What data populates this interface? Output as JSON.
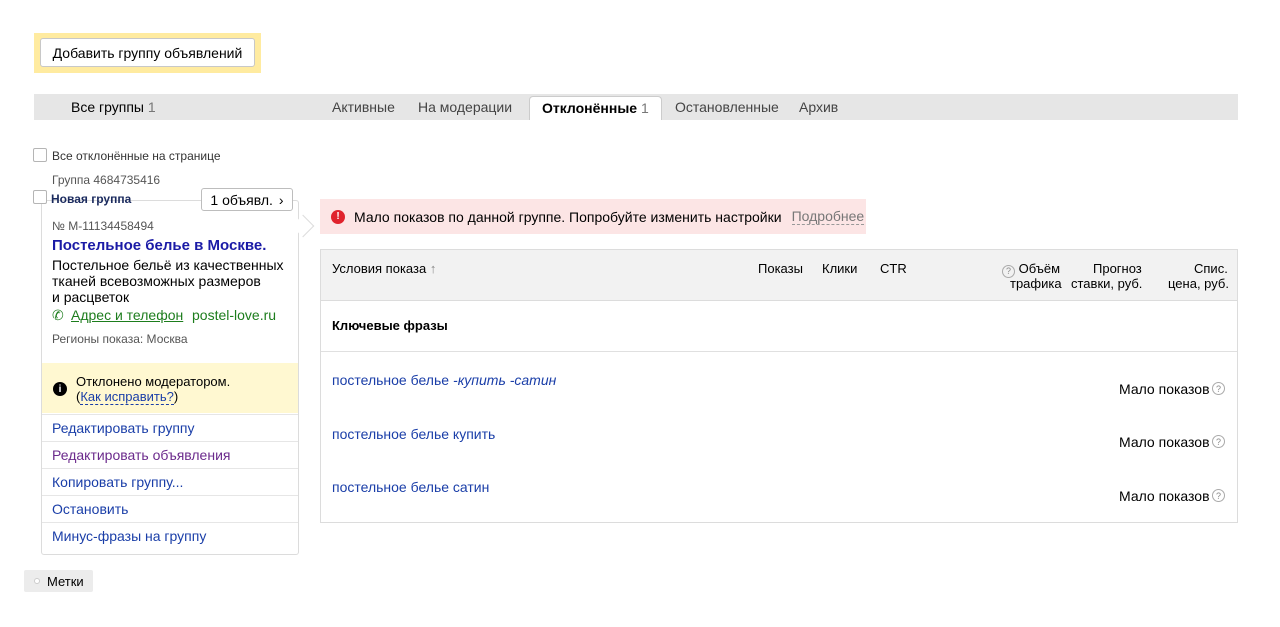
{
  "toolbar": {
    "add_group_label": "Добавить группу объявлений"
  },
  "tabs": {
    "all_label": "Все группы",
    "all_count": "1",
    "active_label": "Активные",
    "moderation_label": "На модерации",
    "rejected_label": "Отклонённые",
    "rejected_count": "1",
    "stopped_label": "Остановленные",
    "archive_label": "Архив"
  },
  "select_all_label": "Все отклонённые на странице",
  "group": {
    "id_label": "Группа 4684735416",
    "name": "Новая группа",
    "ads_count_button": "1 объявл.",
    "ad_number": "№ M-11134458494",
    "ad_title": "Постельное белье в Москве.",
    "ad_text_1": "Постельное бельё из качественных",
    "ad_text_2": "тканей всевозможных размеров",
    "ad_text_3": "и расцветок",
    "address_link": "Адрес и телефон",
    "domain": "postel-love.ru",
    "regions": "Регионы показа: Москва",
    "rejected_msg": "Отклонено модератором.",
    "fix_prefix": "(",
    "fix_link": "Как исправить?",
    "fix_suffix": ")",
    "menu": [
      "Редактировать группу",
      "Редактировать объявления",
      "Копировать группу...",
      "Остановить",
      "Минус-фразы на группу"
    ]
  },
  "alert": {
    "message": "Мало показов по данной группе. Попробуйте изменить настройки",
    "more_link": "Подробнее"
  },
  "table": {
    "col_conditions": "Условия показа",
    "col_conditions_sort": "↑",
    "col_impressions": "Показы",
    "col_clicks": "Клики",
    "col_ctr": "CTR",
    "col_traffic_1": "Объём",
    "col_traffic_2": "трафика",
    "col_forecast_1": "Прогноз",
    "col_forecast_2": "ставки, руб.",
    "col_price_1": "Спис.",
    "col_price_2": "цена, руб.",
    "section_title": "Ключевые фразы",
    "rows": [
      {
        "phrase": "постельное белье",
        "negatives": "-купить -сатин",
        "status": "Мало показов"
      },
      {
        "phrase": "постельное белье купить",
        "negatives": "",
        "status": "Мало показов"
      },
      {
        "phrase": "постельное белье сатин",
        "negatives": "",
        "status": "Мало показов"
      }
    ]
  },
  "tags_label": "Метки",
  "icons": {
    "help": "?",
    "info": "i",
    "error": "!",
    "chevron": "›",
    "phone": "✆"
  },
  "colors": {
    "accent_yellow": "#ffeba0",
    "link_blue": "#1a3ea8",
    "title_blue": "#1a1aa6",
    "green": "#1d7d1d",
    "alert_bg": "#fce5e5",
    "error_red": "#e0232d"
  }
}
